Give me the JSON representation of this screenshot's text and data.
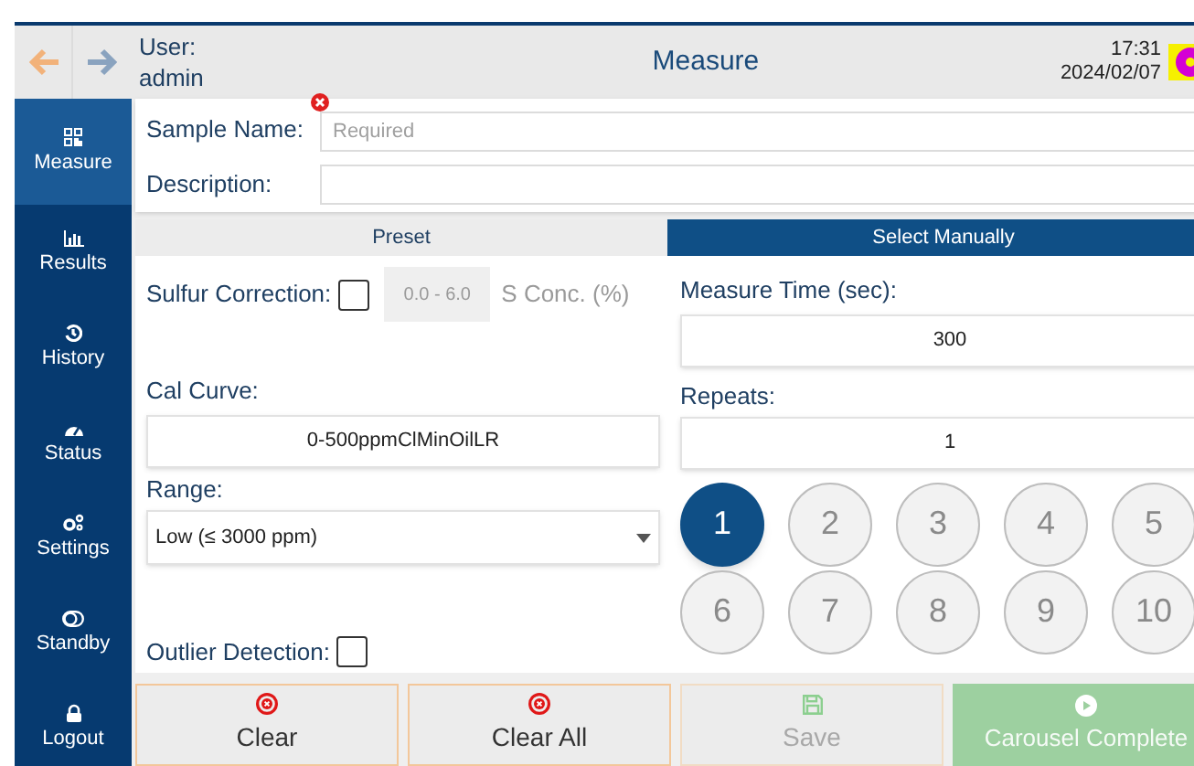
{
  "header": {
    "user_label": "User:",
    "user_name": "admin",
    "title": "Measure",
    "time": "17:31",
    "date": "2024/02/07"
  },
  "sidebar": {
    "items": [
      {
        "label": "Measure",
        "selected": true
      },
      {
        "label": "Results",
        "selected": false
      },
      {
        "label": "History",
        "selected": false
      },
      {
        "label": "Status",
        "selected": false
      },
      {
        "label": "Settings",
        "selected": false
      },
      {
        "label": "Standby",
        "selected": false
      },
      {
        "label": "Logout",
        "selected": false
      }
    ]
  },
  "sample": {
    "name_label": "Sample Name:",
    "name_placeholder": "Required",
    "name_error": true,
    "description_label": "Description:"
  },
  "tabs": [
    {
      "label": "Preset",
      "selected": false
    },
    {
      "label": "Select Manually",
      "selected": true
    }
  ],
  "left": {
    "sulfur_label": "Sulfur Correction:",
    "sulfur_checked": false,
    "sulfur_placeholder": "0.0 - 6.0",
    "sulfur_unit": "S Conc. (%)",
    "cal_label": "Cal Curve:",
    "cal_value": "0-500ppmClMinOilLR",
    "range_label": "Range:",
    "range_value": "Low (≤ 3000 ppm)",
    "outlier_label": "Outlier Detection:",
    "outlier_checked": false
  },
  "right": {
    "time_label": "Measure Time (sec):",
    "time_value": "300",
    "repeats_label": "Repeats:",
    "repeats_value": "1",
    "repeat_options": [
      {
        "label": "1",
        "selected": true
      },
      {
        "label": "2",
        "selected": false
      },
      {
        "label": "3",
        "selected": false
      },
      {
        "label": "4",
        "selected": false
      },
      {
        "label": "5",
        "selected": false
      },
      {
        "label": "6",
        "selected": false
      },
      {
        "label": "7",
        "selected": false
      },
      {
        "label": "8",
        "selected": false
      },
      {
        "label": "9",
        "selected": false
      },
      {
        "label": "10",
        "selected": false
      }
    ]
  },
  "actions": [
    {
      "label": "Clear",
      "kind": "clear",
      "disabled": false
    },
    {
      "label": "Clear All",
      "kind": "clear",
      "disabled": false
    },
    {
      "label": "Save",
      "kind": "save",
      "disabled": true
    },
    {
      "label": "Carousel Complete",
      "kind": "play",
      "disabled": true
    }
  ]
}
